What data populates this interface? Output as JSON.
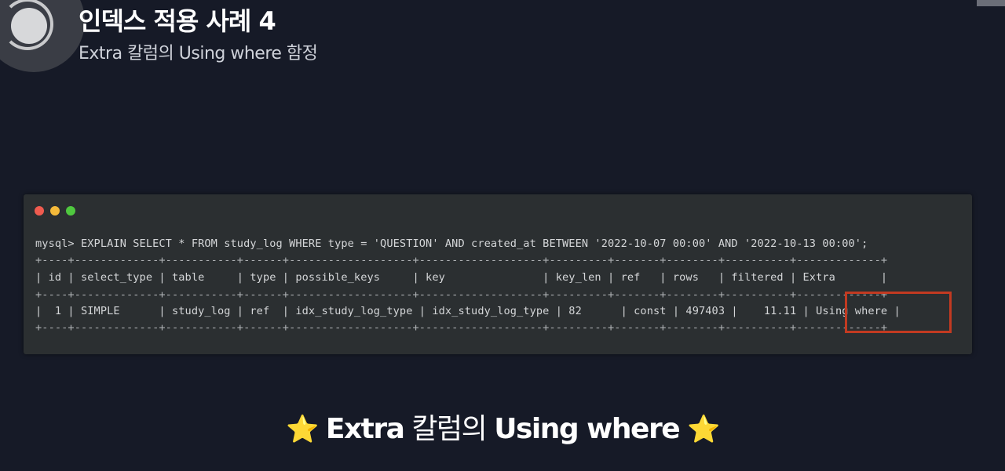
{
  "header": {
    "title": "인덱스 적용 사례 4",
    "subtitle": "Extra 칼럼의 Using where 함정"
  },
  "terminal": {
    "command": "mysql> EXPLAIN SELECT * FROM study_log WHERE type = 'QUESTION' AND created_at BETWEEN '2022-10-07 00:00' AND '2022-10-13 00:00';",
    "separator": "+----+-------------+-----------+------+-------------------+-------------------+---------+-------+--------+----------+-------------+",
    "columns": [
      "id",
      "select_type",
      "table",
      "type",
      "possible_keys",
      "key",
      "key_len",
      "ref",
      "rows",
      "filtered",
      "Extra"
    ],
    "rows": [
      [
        "1",
        "SIMPLE",
        "study_log",
        "ref",
        "idx_study_log_type",
        "idx_study_log_type",
        "82",
        "const",
        "497403",
        "11.11",
        "Using where"
      ]
    ],
    "header_line": "| id | select_type | table     | type | possible_keys     | key               | key_len | ref   | rows   | filtered | Extra       |",
    "row_line": "|  1 | SIMPLE      | study_log | ref  | idx_study_log_type | idx_study_log_type | 82      | const | 497403 |    11.11 | Using where |"
  },
  "caption": {
    "star": "⭐",
    "part1": "Extra",
    "part2": "칼럼의",
    "part3": "Using where"
  },
  "colors": {
    "background": "#161a27",
    "terminal": "#2b2f31",
    "highlight": "#c23a21"
  }
}
